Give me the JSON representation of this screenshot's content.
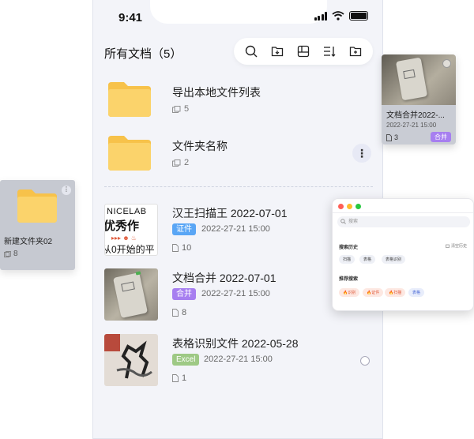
{
  "status_bar": {
    "time": "9:41"
  },
  "header": {
    "title": "所有文档（5）"
  },
  "toolbar": {
    "icons": [
      "search-icon",
      "import-folder-icon",
      "grid-view-icon",
      "sort-icon",
      "new-folder-icon"
    ]
  },
  "folders": [
    {
      "name": "导出本地文件列表",
      "count": "5"
    },
    {
      "name": "文件夹名称",
      "count": "2"
    }
  ],
  "documents": [
    {
      "name": "汉王扫描王 2022-07-01",
      "tag": "证件",
      "tag_color": "#5aa6f5",
      "date": "2022-27-21 15:00",
      "pages": "10",
      "thumb_text_top": "NICELAB",
      "thumb_text_mid": "优秀作",
      "thumb_text_bot": "从0开始的平"
    },
    {
      "name": "文档合并 2022-07-01",
      "tag": "合并",
      "tag_color": "#a77ff0",
      "date": "2022-27-21 15:00",
      "pages": "8"
    },
    {
      "name": "表格识别文件 2022-05-28",
      "tag": "Excel",
      "tag_color": "#9ec985",
      "date": "2022-27-21 15:00",
      "pages": "1"
    }
  ],
  "left_card": {
    "name": "新建文件夹02",
    "count": "8"
  },
  "right_card": {
    "name": "文档合并2022-...",
    "date": "2022-27-21 15:00",
    "count": "3",
    "tag": "合并"
  },
  "search_window": {
    "placeholder": "搜索",
    "history_label": "搜索历史",
    "clear_label": "清空历史",
    "history": [
      "扫描",
      "表格",
      "表格识别"
    ],
    "recommend_label": "推荐搜索",
    "recommend": [
      "识别",
      "证件",
      "扫描",
      "表格"
    ]
  },
  "colors": {
    "folder": "#fbd36b",
    "folder_dark": "#f7c24a",
    "accent_purple": "#a77ff0",
    "accent_blue": "#5aa6f5"
  }
}
